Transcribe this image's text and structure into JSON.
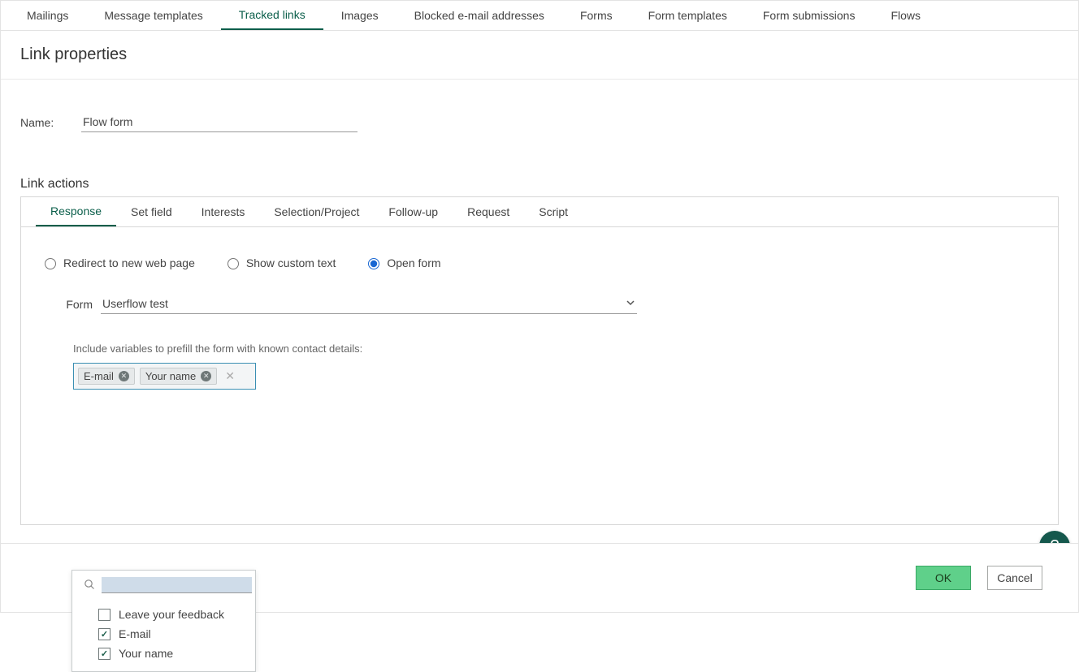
{
  "top_tabs": {
    "items": [
      {
        "label": "Mailings"
      },
      {
        "label": "Message templates"
      },
      {
        "label": "Tracked links"
      },
      {
        "label": "Images"
      },
      {
        "label": "Blocked e-mail addresses"
      },
      {
        "label": "Forms"
      },
      {
        "label": "Form templates"
      },
      {
        "label": "Form submissions"
      },
      {
        "label": "Flows"
      }
    ],
    "active_index": 2
  },
  "page_title": "Link properties",
  "name_field": {
    "label": "Name:",
    "value": "Flow form"
  },
  "link_actions": {
    "title": "Link actions",
    "tabs": [
      {
        "label": "Response"
      },
      {
        "label": "Set field"
      },
      {
        "label": "Interests"
      },
      {
        "label": "Selection/Project"
      },
      {
        "label": "Follow-up"
      },
      {
        "label": "Request"
      },
      {
        "label": "Script"
      }
    ],
    "active_index": 0,
    "radios": {
      "redirect": "Redirect to new web page",
      "custom_text": "Show custom text",
      "open_form": "Open form",
      "selected": "open_form"
    },
    "form_select": {
      "label": "Form",
      "value": "Userflow test"
    },
    "prefill": {
      "label": "Include variables to prefill the form with known contact details:",
      "chips": [
        {
          "label": "E-mail"
        },
        {
          "label": "Your name"
        }
      ],
      "options": [
        {
          "label": "Leave your feedback",
          "checked": false
        },
        {
          "label": "E-mail",
          "checked": true
        },
        {
          "label": "Your name",
          "checked": true
        }
      ]
    }
  },
  "footer": {
    "ok": "OK",
    "cancel": "Cancel"
  },
  "help": "?"
}
